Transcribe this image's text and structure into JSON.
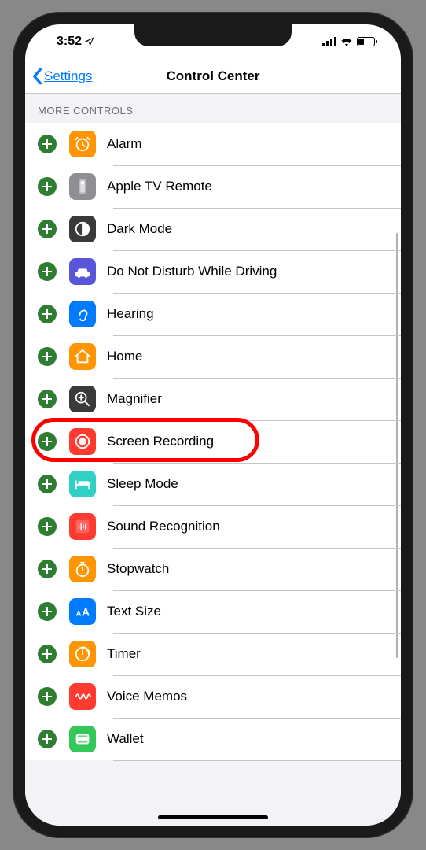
{
  "status": {
    "time": "3:52"
  },
  "nav": {
    "back_label": "Settings",
    "title": "Control Center"
  },
  "section": {
    "header": "MORE CONTROLS"
  },
  "items": [
    {
      "label": "Alarm",
      "icon": "alarm",
      "bg": "ic-orange"
    },
    {
      "label": "Apple TV Remote",
      "icon": "remote",
      "bg": "ic-gray"
    },
    {
      "label": "Dark Mode",
      "icon": "dark-mode",
      "bg": "ic-darkgray"
    },
    {
      "label": "Do Not Disturb While Driving",
      "icon": "car",
      "bg": "ic-purple"
    },
    {
      "label": "Hearing",
      "icon": "ear",
      "bg": "ic-blue"
    },
    {
      "label": "Home",
      "icon": "home",
      "bg": "ic-orange"
    },
    {
      "label": "Magnifier",
      "icon": "magnifier",
      "bg": "ic-darkgray"
    },
    {
      "label": "Screen Recording",
      "icon": "record",
      "bg": "ic-red",
      "highlighted": true
    },
    {
      "label": "Sleep Mode",
      "icon": "bed",
      "bg": "ic-teal"
    },
    {
      "label": "Sound Recognition",
      "icon": "sound-recognition",
      "bg": "ic-red"
    },
    {
      "label": "Stopwatch",
      "icon": "stopwatch",
      "bg": "ic-orange"
    },
    {
      "label": "Text Size",
      "icon": "text-size",
      "bg": "ic-blue"
    },
    {
      "label": "Timer",
      "icon": "timer",
      "bg": "ic-orange"
    },
    {
      "label": "Voice Memos",
      "icon": "voice-memos",
      "bg": "ic-red"
    },
    {
      "label": "Wallet",
      "icon": "wallet",
      "bg": "ic-green"
    }
  ]
}
